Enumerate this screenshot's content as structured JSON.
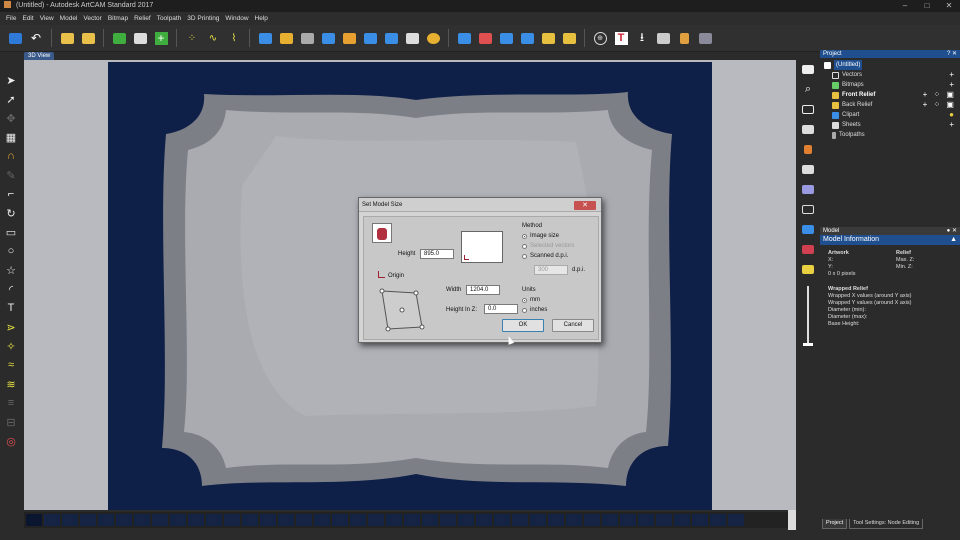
{
  "window": {
    "title": "(Untitled) - Autodesk ArtCAM Standard 2017"
  },
  "menu": [
    "File",
    "Edit",
    "View",
    "Model",
    "Vector",
    "Bitmap",
    "Relief",
    "Toolpath",
    "3D Printing",
    "Window",
    "Help"
  ],
  "view_tab": "3D View",
  "project_panel": {
    "title": "Project",
    "items": [
      {
        "label": "(Untitled)",
        "icon": "document-icon"
      },
      {
        "label": "Vectors",
        "icon": "vectors-icon"
      },
      {
        "label": "Bitmaps",
        "icon": "bitmaps-icon"
      },
      {
        "label": "Front Relief",
        "icon": "star-icon"
      },
      {
        "label": "Back Relief",
        "icon": "star-icon"
      },
      {
        "label": "Clipart",
        "icon": "clipart-icon"
      },
      {
        "label": "Sheets",
        "icon": "sheets-icon"
      },
      {
        "label": "Toolpaths",
        "icon": "toolpaths-icon"
      }
    ]
  },
  "model_panel": {
    "title": "Model",
    "info_title": "Model Information",
    "artwork_heading": "Artwork",
    "x_label": "X:",
    "y_label": "Y:",
    "pixels": "0 x 0 pixels",
    "relief_heading": "Relief",
    "max_z": "Max. Z:",
    "min_z": "Min. Z:",
    "wrapped_heading": "Wrapped Relief",
    "wrapped_lines": [
      "Wrapped X values (around Y axis)",
      "Wrapped Y values (around X axis)",
      "Diameter (min):",
      "Diameter (max):",
      "Base Height:"
    ]
  },
  "bottom_tabs": [
    "Project",
    "Tool Settings: Node Editing"
  ],
  "dialog": {
    "title": "Set Model Size",
    "close_label": "✕",
    "height_label": "Height",
    "height_value": "895.0",
    "width_label": "Width",
    "width_value": "1204.0",
    "height_in_z_label": "Height In Z:",
    "height_in_z_value": "0.0",
    "origin_label": "Origin",
    "method_heading": "Method",
    "method_options": [
      "Image size",
      "Selected vectors",
      "Scanned d.p.i."
    ],
    "dpi_value": "300",
    "dpi_label": "d.p.i.",
    "units_heading": "Units",
    "unit_options": [
      "mm",
      "inches"
    ],
    "ok_label": "OK",
    "cancel_label": "Cancel"
  },
  "colors": {
    "model_background": "#0e1f48",
    "canvas_background": "#b9bac0",
    "panel_header": "#1f4f8f",
    "frame_outer": "#7d7f87",
    "frame_inner": "#a9abb1"
  }
}
